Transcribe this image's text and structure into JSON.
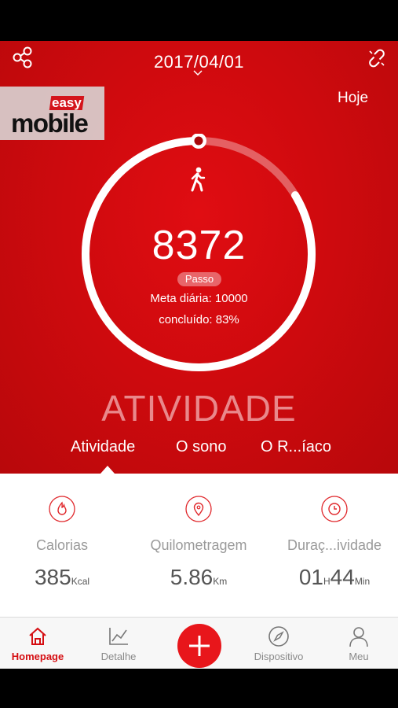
{
  "header": {
    "date": "2017/04/01",
    "today_label": "Hoje",
    "share_icon": "share-icon",
    "unlink_icon": "unlink-icon"
  },
  "logo": {
    "easy": "easy",
    "mobile": "mobile"
  },
  "activity": {
    "steps": "8372",
    "unit": "Passo",
    "goal_text": "Meta diária: 10000",
    "completed_text": "concluído: 83%",
    "progress": 0.837,
    "icon": "walking-person-icon"
  },
  "section_title": "ATIVIDADE",
  "tabs": [
    {
      "label": "Atividade",
      "active": true
    },
    {
      "label": "O sono",
      "active": false
    },
    {
      "label": "O R...íaco",
      "active": false
    }
  ],
  "metrics": [
    {
      "label": "Calorias",
      "value": "385",
      "unit": "Kcal",
      "icon": "flame-icon"
    },
    {
      "label": "Quilometragem",
      "value": "5.86",
      "unit": "Km",
      "icon": "location-pin-icon"
    },
    {
      "label": "Duraç...ividade",
      "value_h": "01",
      "unit_h": "H",
      "value_m": "44",
      "unit_m": "Min",
      "icon": "clock-icon"
    }
  ],
  "nav": [
    {
      "label": "Homepage",
      "icon": "home-icon",
      "active": true
    },
    {
      "label": "Detalhe",
      "icon": "line-chart-icon",
      "active": false
    },
    {
      "label": "",
      "icon": "plus-icon",
      "active": false
    },
    {
      "label": "Dispositivo",
      "icon": "compass-icon",
      "active": false
    },
    {
      "label": "Meu",
      "icon": "user-icon",
      "active": false
    }
  ],
  "colors": {
    "brand_red": "#d50e12",
    "ring": "#ffffff",
    "muted_text": "#9a9a9a"
  }
}
